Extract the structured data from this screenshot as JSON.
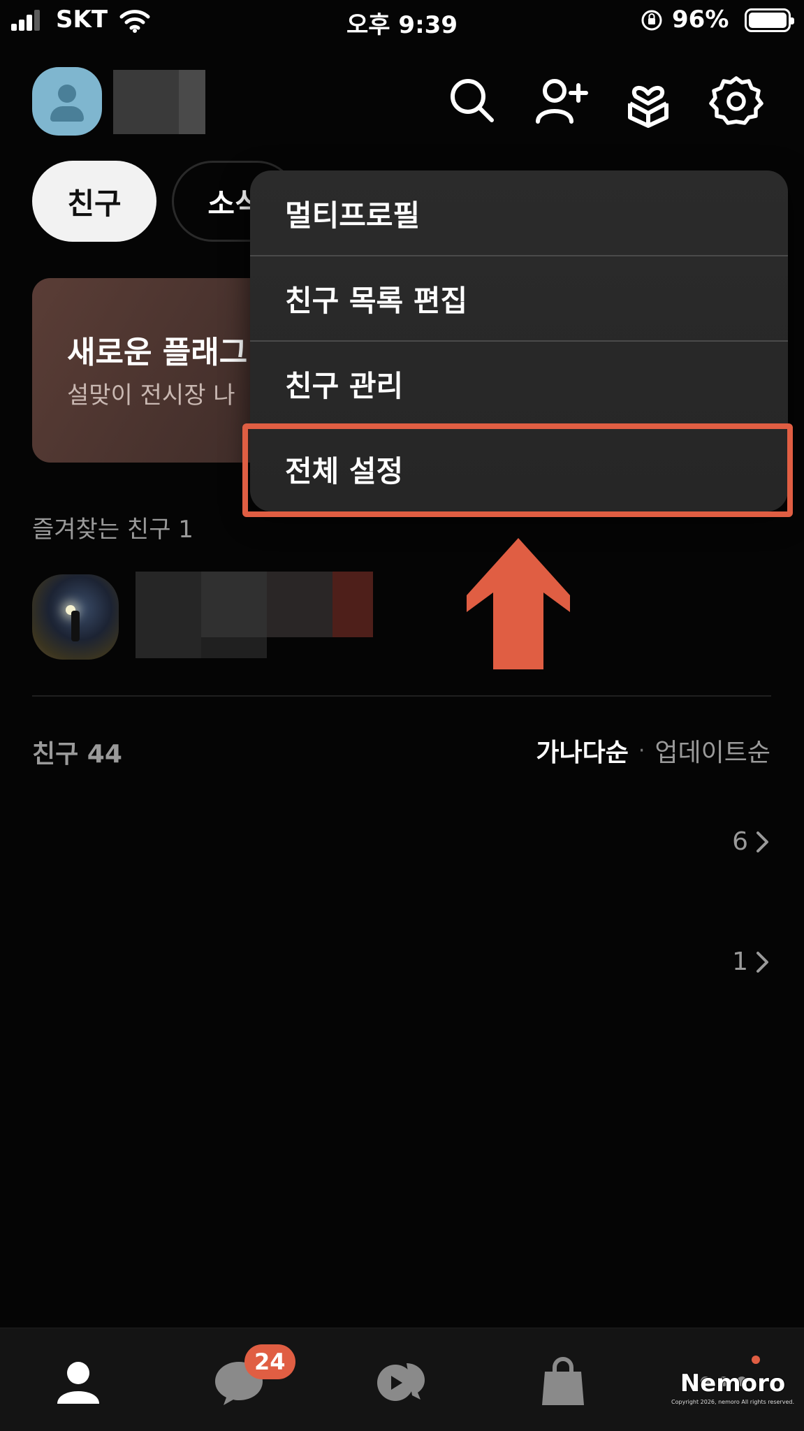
{
  "status_bar": {
    "carrier": "SKT",
    "time": "오후 9:39",
    "battery_percent": "96%"
  },
  "header": {
    "icons": [
      "search-icon",
      "add-friend-icon",
      "gift-icon",
      "settings-icon"
    ]
  },
  "filters": {
    "friends": "친구",
    "news": "소식"
  },
  "banner": {
    "title": "새로운 플래그",
    "subtitle": "설맞이 전시장 나"
  },
  "favorites": {
    "label": "즐겨찾는 친구 1"
  },
  "friends": {
    "count_label": "친구 44",
    "sort_active": "가나다순",
    "sort_separator": "·",
    "sort_inactive": "업데이트순",
    "group_counts": [
      "6",
      "1"
    ]
  },
  "menu": {
    "items": [
      "멀티프로필",
      "친구 목록 편집",
      "친구 관리",
      "전체 설정"
    ],
    "highlighted_index": 3
  },
  "tab_bar": {
    "chat_badge": "24",
    "tabs": [
      "friends-tab",
      "chats-tab",
      "openchat-tab",
      "shopping-tab",
      "more-tab"
    ]
  },
  "watermark": {
    "brand": "Nemoro",
    "copyright": "Copyright 2026, nemoro All rights reserved."
  },
  "colors": {
    "accent": "#e05e43",
    "background": "#050505",
    "menu_bg": "#2b2b2b"
  }
}
